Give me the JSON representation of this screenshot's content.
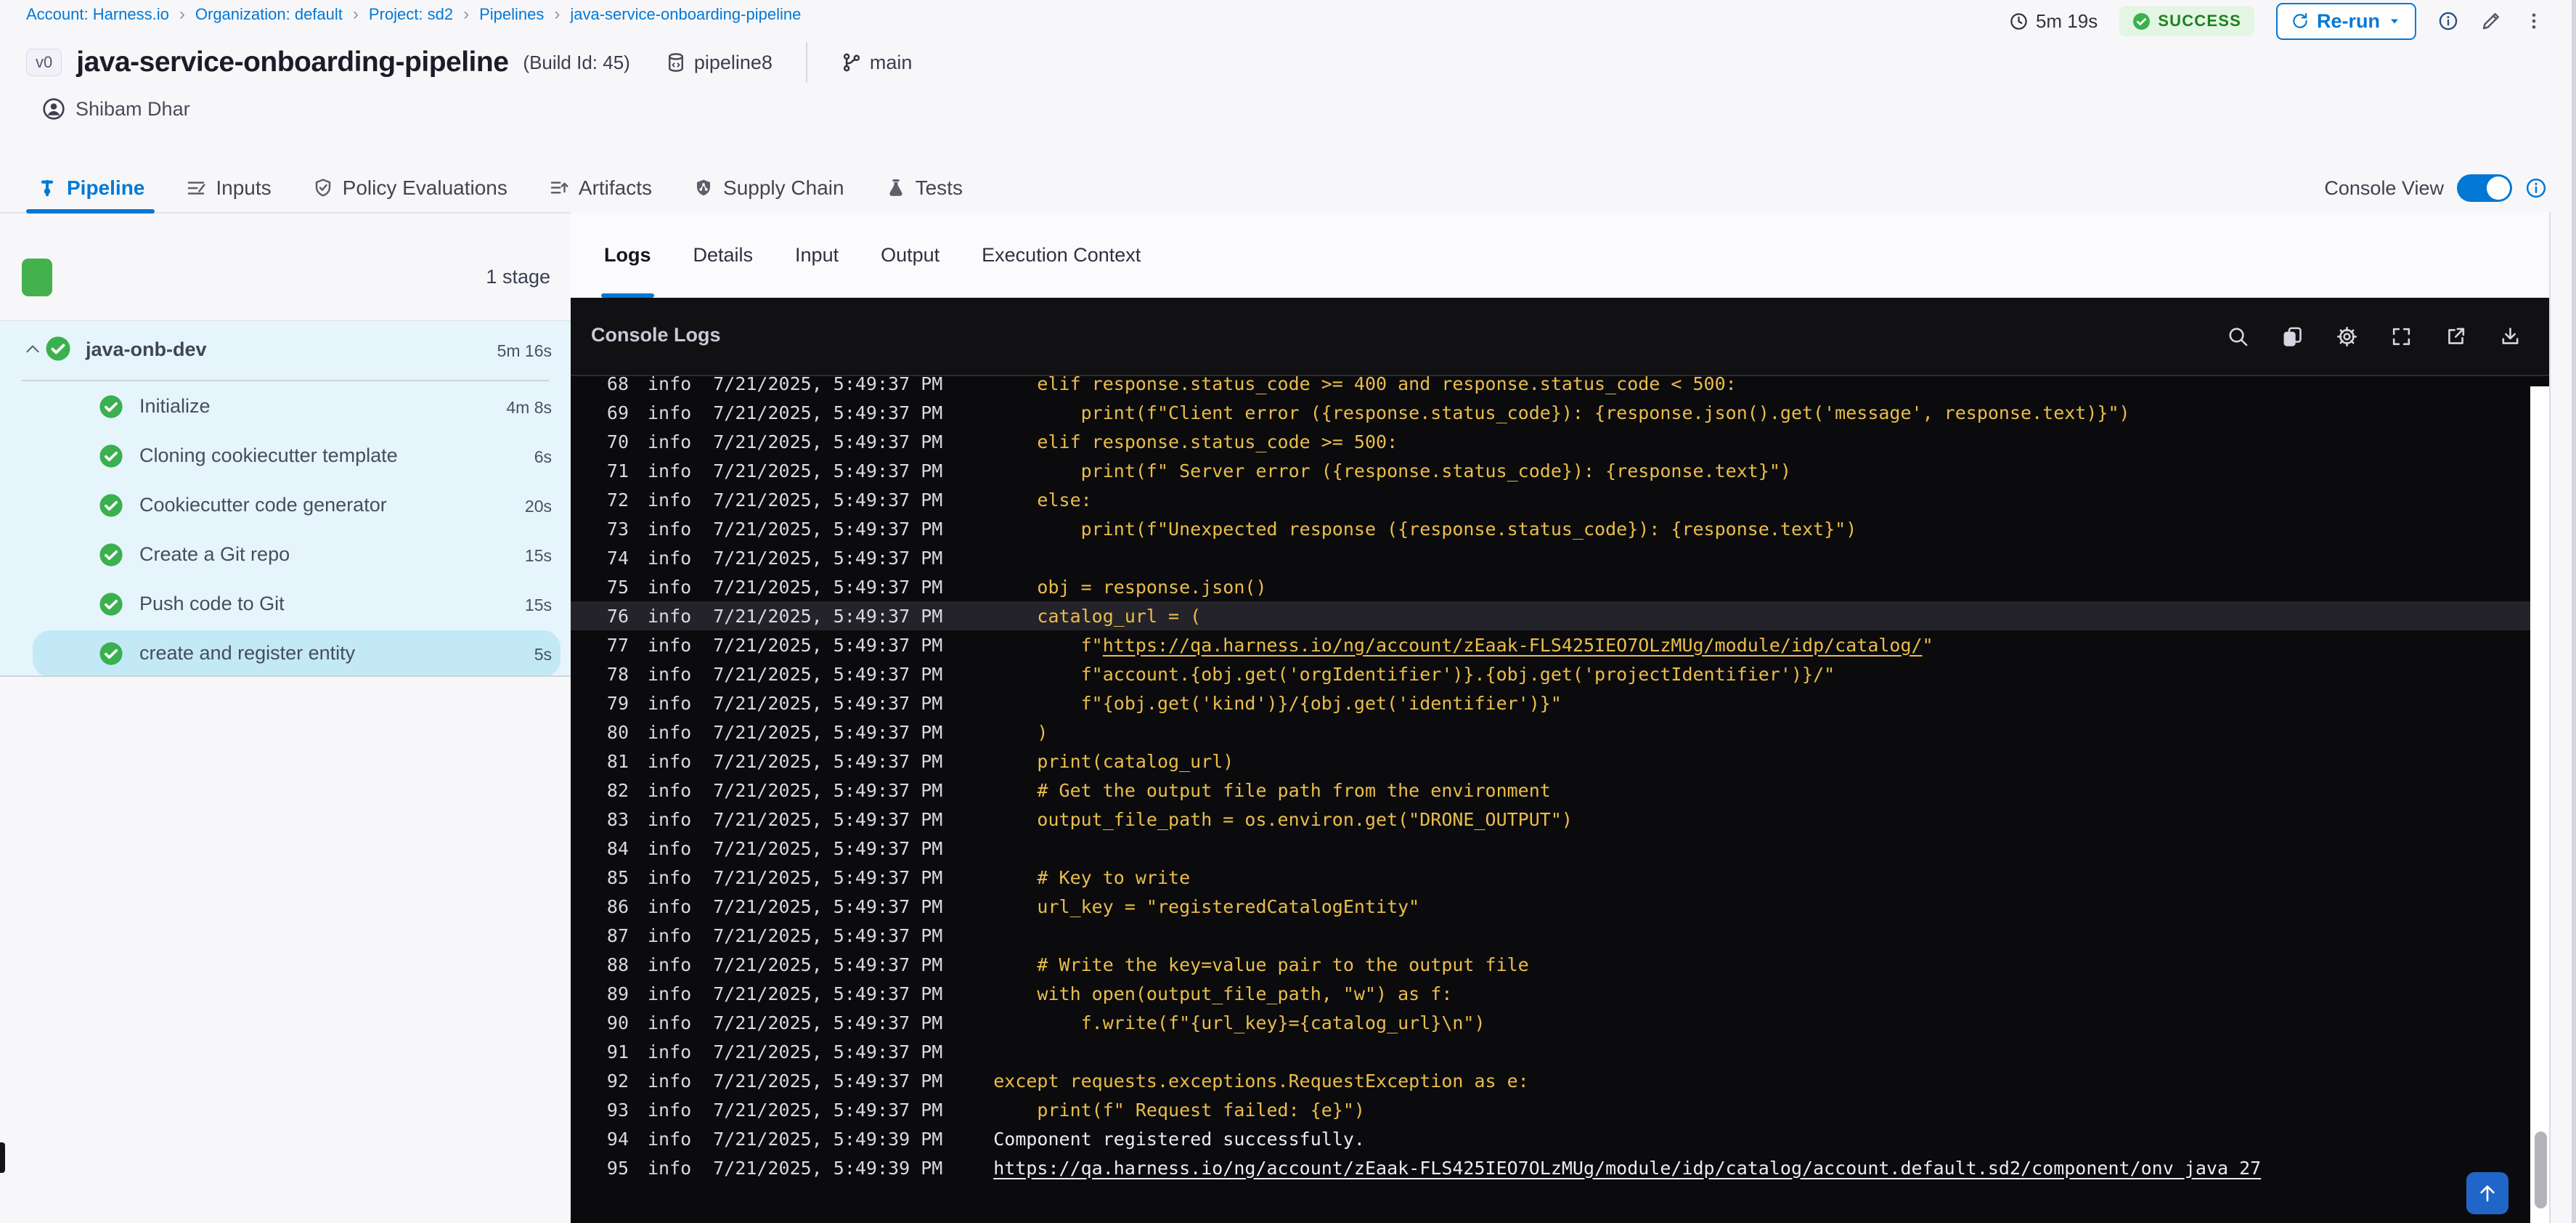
{
  "colors": {
    "accent": "#0278d5",
    "success_green": "#3ab04f",
    "success_badge_bg": "#e3f6e3",
    "success_badge_text": "#1f8024",
    "stage_list_bg": "#e6f5fb",
    "selected_step_bg": "#c3e9f6",
    "console_bg": "#0b0b0d",
    "console_row_highlight": "#232329",
    "log_code_yellow": "#eabd4b",
    "log_plain_white": "#ececf0"
  },
  "breadcrumb": {
    "separator": "›",
    "items": [
      "Account: Harness.io",
      "Organization: default",
      "Project: sd2",
      "Pipelines",
      "java-service-onboarding-pipeline"
    ]
  },
  "header": {
    "duration": "5m 19s",
    "duration_icon": "clock-icon",
    "status": "SUCCESS",
    "status_icon": "check-circle-icon",
    "rerun_label": "Re-run",
    "rerun_icons": [
      "rerun-icon",
      "caret-down-icon"
    ],
    "action_icons": [
      "info-icon",
      "pencil-icon",
      "kebab-icon"
    ],
    "version_badge": "v0",
    "title": "java-service-onboarding-pipeline",
    "build_id": "(Build Id: 45)",
    "pipeline_tag": "pipeline8",
    "pipeline_tag_icon": "db-icon",
    "branch": "main",
    "branch_icon": "branch-icon",
    "user": "Shibam Dhar",
    "user_icon": "person-icon"
  },
  "nav_tabs": {
    "items": [
      {
        "id": "pipeline",
        "label": "Pipeline",
        "icon": "pipeline-icon",
        "active": true
      },
      {
        "id": "inputs",
        "label": "Inputs",
        "icon": "inputs-icon",
        "active": false
      },
      {
        "id": "policy-evaluations",
        "label": "Policy Evaluations",
        "icon": "policy-icon",
        "active": false
      },
      {
        "id": "artifacts",
        "label": "Artifacts",
        "icon": "artifacts-icon",
        "active": false
      },
      {
        "id": "supply-chain",
        "label": "Supply Chain",
        "icon": "supply-chain-icon",
        "active": false
      },
      {
        "id": "tests",
        "label": "Tests",
        "icon": "tests-icon",
        "active": false
      }
    ],
    "console_view": {
      "label": "Console View",
      "enabled": true,
      "info_icon": "info-icon"
    }
  },
  "stage_panel": {
    "stage_count": "1 stage",
    "stage": {
      "name": "java-onb-dev",
      "duration": "5m 16s",
      "status": "success",
      "collapse_icon": "chevron-up-icon"
    },
    "steps": [
      {
        "name": "Initialize",
        "duration": "4m 8s",
        "selected": false
      },
      {
        "name": "Cloning cookiecutter template",
        "duration": "6s",
        "selected": false
      },
      {
        "name": "Cookiecutter code generator",
        "duration": "20s",
        "selected": false
      },
      {
        "name": "Create a Git repo",
        "duration": "15s",
        "selected": false
      },
      {
        "name": "Push code to Git",
        "duration": "15s",
        "selected": false
      },
      {
        "name": "create and register entity",
        "duration": "5s",
        "selected": true
      }
    ]
  },
  "log_panel": {
    "tabs": [
      {
        "label": "Logs",
        "active": true
      },
      {
        "label": "Details",
        "active": false
      },
      {
        "label": "Input",
        "active": false
      },
      {
        "label": "Output",
        "active": false
      },
      {
        "label": "Execution Context",
        "active": false
      }
    ],
    "console_title": "Console Logs",
    "toolbar_icons": [
      "search-icon",
      "copy-icon",
      "settings-icon",
      "fullscreen-icon",
      "open-in-new-icon",
      "download-icon"
    ],
    "scroll_top_icon": "up-arrow-icon",
    "rows": [
      {
        "n": "68",
        "level": "info",
        "time": "7/21/2025, 5:49:37 PM",
        "kind": "code",
        "text": "    elif response.status_code >= 400 and response.status_code < 500:"
      },
      {
        "n": "69",
        "level": "info",
        "time": "7/21/2025, 5:49:37 PM",
        "kind": "code",
        "text": "        print(f\"Client error ({response.status_code}): {response.json().get('message', response.text)}\")"
      },
      {
        "n": "70",
        "level": "info",
        "time": "7/21/2025, 5:49:37 PM",
        "kind": "code",
        "text": "    elif response.status_code >= 500:"
      },
      {
        "n": "71",
        "level": "info",
        "time": "7/21/2025, 5:49:37 PM",
        "kind": "code",
        "text": "        print(f\" Server error ({response.status_code}): {response.text}\")"
      },
      {
        "n": "72",
        "level": "info",
        "time": "7/21/2025, 5:49:37 PM",
        "kind": "code",
        "text": "    else:"
      },
      {
        "n": "73",
        "level": "info",
        "time": "7/21/2025, 5:49:37 PM",
        "kind": "code",
        "text": "        print(f\"Unexpected response ({response.status_code}): {response.text}\")"
      },
      {
        "n": "74",
        "level": "info",
        "time": "7/21/2025, 5:49:37 PM",
        "kind": "code",
        "text": ""
      },
      {
        "n": "75",
        "level": "info",
        "time": "7/21/2025, 5:49:37 PM",
        "kind": "code",
        "text": "    obj = response.json()"
      },
      {
        "n": "76",
        "level": "info",
        "time": "7/21/2025, 5:49:37 PM",
        "kind": "code",
        "text": "    catalog_url = (",
        "highlight": true
      },
      {
        "n": "77",
        "level": "info",
        "time": "7/21/2025, 5:49:37 PM",
        "kind": "code",
        "pre": "        f\"",
        "link": "https://qa.harness.io/ng/account/zEaak-FLS425IEO7OLzMUg/module/idp/catalog/",
        "post": "\""
      },
      {
        "n": "78",
        "level": "info",
        "time": "7/21/2025, 5:49:37 PM",
        "kind": "code",
        "text": "        f\"account.{obj.get('orgIdentifier')}.{obj.get('projectIdentifier')}/\""
      },
      {
        "n": "79",
        "level": "info",
        "time": "7/21/2025, 5:49:37 PM",
        "kind": "code",
        "text": "        f\"{obj.get('kind')}/{obj.get('identifier')}\""
      },
      {
        "n": "80",
        "level": "info",
        "time": "7/21/2025, 5:49:37 PM",
        "kind": "code",
        "text": "    )"
      },
      {
        "n": "81",
        "level": "info",
        "time": "7/21/2025, 5:49:37 PM",
        "kind": "code",
        "text": "    print(catalog_url)"
      },
      {
        "n": "82",
        "level": "info",
        "time": "7/21/2025, 5:49:37 PM",
        "kind": "code",
        "text": "    # Get the output file path from the environment"
      },
      {
        "n": "83",
        "level": "info",
        "time": "7/21/2025, 5:49:37 PM",
        "kind": "code",
        "text": "    output_file_path = os.environ.get(\"DRONE_OUTPUT\")"
      },
      {
        "n": "84",
        "level": "info",
        "time": "7/21/2025, 5:49:37 PM",
        "kind": "code",
        "text": ""
      },
      {
        "n": "85",
        "level": "info",
        "time": "7/21/2025, 5:49:37 PM",
        "kind": "code",
        "text": "    # Key to write"
      },
      {
        "n": "86",
        "level": "info",
        "time": "7/21/2025, 5:49:37 PM",
        "kind": "code",
        "text": "    url_key = \"registeredCatalogEntity\""
      },
      {
        "n": "87",
        "level": "info",
        "time": "7/21/2025, 5:49:37 PM",
        "kind": "code",
        "text": ""
      },
      {
        "n": "88",
        "level": "info",
        "time": "7/21/2025, 5:49:37 PM",
        "kind": "code",
        "text": "    # Write the key=value pair to the output file"
      },
      {
        "n": "89",
        "level": "info",
        "time": "7/21/2025, 5:49:37 PM",
        "kind": "code",
        "text": "    with open(output_file_path, \"w\") as f:"
      },
      {
        "n": "90",
        "level": "info",
        "time": "7/21/2025, 5:49:37 PM",
        "kind": "code",
        "text": "        f.write(f\"{url_key}={catalog_url}\\n\")"
      },
      {
        "n": "91",
        "level": "info",
        "time": "7/21/2025, 5:49:37 PM",
        "kind": "code",
        "text": ""
      },
      {
        "n": "92",
        "level": "info",
        "time": "7/21/2025, 5:49:37 PM",
        "kind": "code",
        "text": "except requests.exceptions.RequestException as e:"
      },
      {
        "n": "93",
        "level": "info",
        "time": "7/21/2025, 5:49:37 PM",
        "kind": "code",
        "text": "    print(f\" Request failed: {e}\")"
      },
      {
        "n": "94",
        "level": "info",
        "time": "7/21/2025, 5:49:39 PM",
        "kind": "plain",
        "text": "Component registered successfully."
      },
      {
        "n": "95",
        "level": "info",
        "time": "7/21/2025, 5:49:39 PM",
        "kind": "plain",
        "pre": "",
        "link": "https://qa.harness.io/ng/account/zEaak-FLS425IEO7OLzMUg/module/idp/catalog/account.default.sd2/component/onv_java_27",
        "post": ""
      }
    ]
  }
}
